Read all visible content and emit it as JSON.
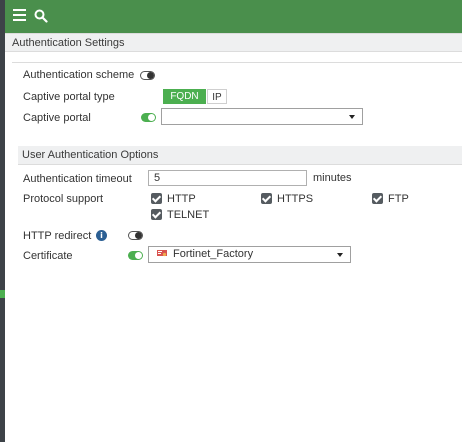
{
  "header": {
    "section_title": "Authentication Settings"
  },
  "authentication": {
    "scheme_label": "Authentication scheme",
    "scheme_enabled": false,
    "portal_type_label": "Captive portal type",
    "portal_type_options": [
      "FQDN",
      "IP"
    ],
    "portal_type_selected": "FQDN",
    "portal_label": "Captive portal",
    "portal_enabled": true,
    "portal_value": ""
  },
  "user_options": {
    "section_title": "User Authentication Options",
    "timeout_label": "Authentication timeout",
    "timeout_value": "5",
    "timeout_unit": "minutes",
    "protocol_label": "Protocol support",
    "protocols": [
      {
        "label": "HTTP",
        "checked": true
      },
      {
        "label": "HTTPS",
        "checked": true
      },
      {
        "label": "FTP",
        "checked": true
      },
      {
        "label": "TELNET",
        "checked": true
      }
    ],
    "redirect_label": "HTTP redirect",
    "redirect_enabled": false,
    "certificate_label": "Certificate",
    "certificate_enabled": true,
    "certificate_value": "Fortinet_Factory"
  },
  "colors": {
    "topbar": "#4a8f4c",
    "accent": "#4caf50",
    "rail": "#3d4248"
  },
  "icons": [
    "menu-icon",
    "search-icon",
    "info-icon",
    "certificate-icon",
    "chevron-down-icon"
  ]
}
